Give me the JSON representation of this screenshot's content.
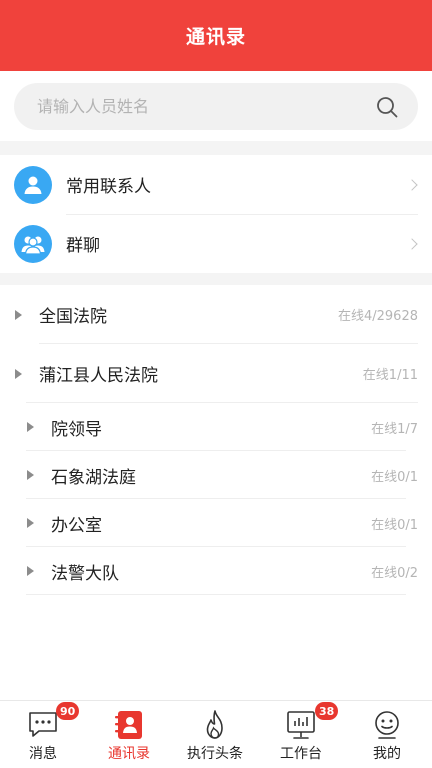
{
  "header": {
    "title": "通讯录"
  },
  "search": {
    "placeholder": "请输入人员姓名",
    "value": ""
  },
  "favorites": [
    {
      "label": "常用联系人",
      "icon": "contact-person-icon"
    },
    {
      "label": "群聊",
      "icon": "group-chat-icon"
    }
  ],
  "tree": {
    "courts": [
      {
        "name": "全国法院",
        "count": "在线4/29628"
      },
      {
        "name": "蒲江县人民法院",
        "count": "在线1/11"
      }
    ],
    "departments": [
      {
        "name": "院领导",
        "count": "在线1/7"
      },
      {
        "name": "石象湖法庭",
        "count": "在线0/1"
      },
      {
        "name": "办公室",
        "count": "在线0/1"
      },
      {
        "name": "法警大队",
        "count": "在线0/2"
      }
    ]
  },
  "tabbar": {
    "active": "通讯录",
    "accent": "#e8372f",
    "tabs": [
      {
        "label": "消息",
        "icon": "message-icon",
        "badge": "90"
      },
      {
        "label": "通讯录",
        "icon": "address-book-icon",
        "badge": ""
      },
      {
        "label": "执行头条",
        "icon": "flame-icon",
        "badge": ""
      },
      {
        "label": "工作台",
        "icon": "workbench-icon",
        "badge": "38"
      },
      {
        "label": "我的",
        "icon": "profile-icon",
        "badge": ""
      }
    ]
  }
}
